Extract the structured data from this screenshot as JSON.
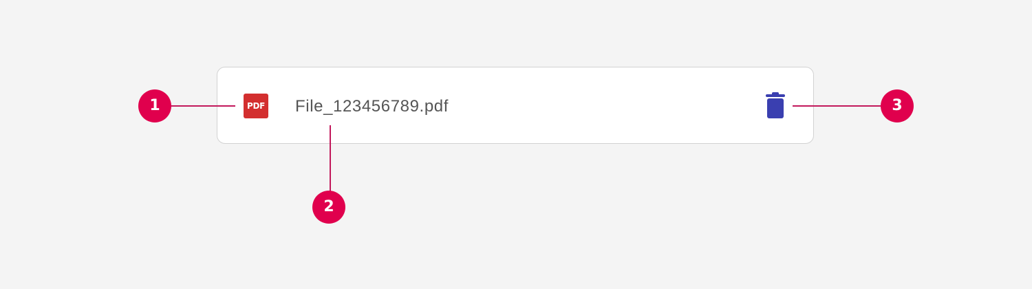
{
  "file_item": {
    "type_icon_label": "PDF",
    "file_name": "File_123456789.pdf",
    "delete_icon": "trash-icon"
  },
  "callouts": [
    "1",
    "2",
    "3"
  ],
  "colors": {
    "background": "#f4f4f4",
    "card_border": "#d2d2d2",
    "pdf_icon": "#d32f2f",
    "delete_icon": "#3a3fb0",
    "callout": "#e0004d"
  }
}
